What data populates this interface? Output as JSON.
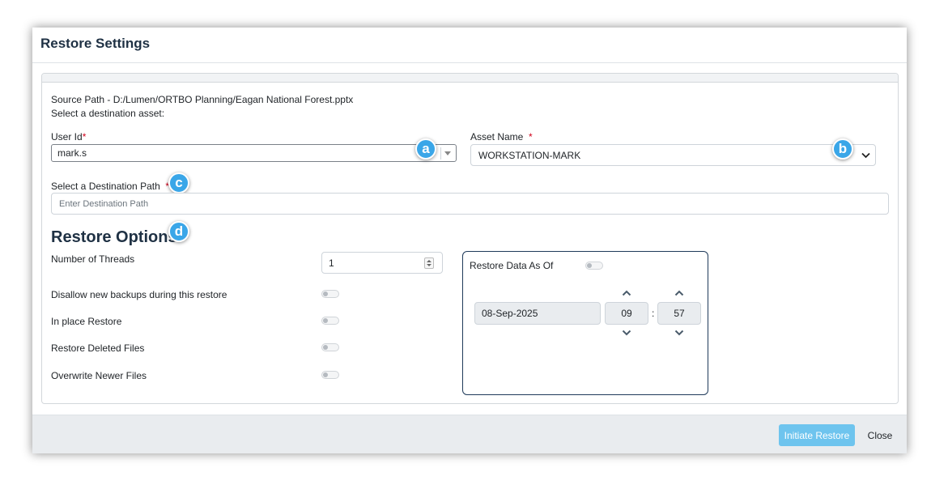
{
  "dialog": {
    "title": "Restore Settings"
  },
  "source": {
    "path_text": "Source Path - D:/Lumen/ORTBO Planning/Eagan National Forest.pptx",
    "select_asset_text": "Select a destination asset:"
  },
  "user_id": {
    "label": "User Id",
    "required_mark": "*",
    "value": "mark.s"
  },
  "asset_name": {
    "label": "Asset Name",
    "required_mark": "*",
    "value": "WORKSTATION-MARK"
  },
  "destination_path": {
    "label": "Select a Destination Path",
    "required_mark": "*",
    "placeholder": "Enter Destination Path"
  },
  "callouts": {
    "a": "a",
    "b": "b",
    "c": "c",
    "d": "d"
  },
  "restore_options": {
    "title": "Restore Options",
    "threads": {
      "label": "Number of Threads",
      "value": "1"
    },
    "toggles": [
      {
        "label": "Disallow new backups during this restore",
        "on": false
      },
      {
        "label": "In place Restore",
        "on": false
      },
      {
        "label": "Restore Deleted Files",
        "on": false
      },
      {
        "label": "Overwrite Newer Files",
        "on": false
      }
    ]
  },
  "restore_as_of": {
    "label": "Restore Data As Of",
    "enabled": false,
    "date": "08-Sep-2025",
    "hour": "09",
    "separator": ":",
    "minute": "57"
  },
  "footer": {
    "initiate_label": "Initiate Restore",
    "close_label": "Close"
  },
  "colors": {
    "accent": "#3aa6e8",
    "primary_button": "#6ec4ee",
    "title": "#1f3144",
    "required": "#d0021b"
  }
}
